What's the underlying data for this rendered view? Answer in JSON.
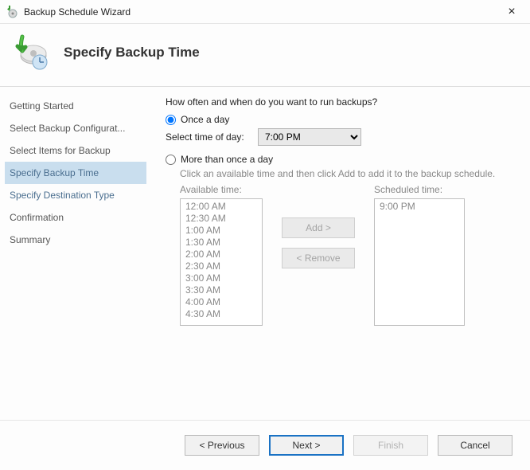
{
  "window": {
    "title": "Backup Schedule Wizard"
  },
  "header": {
    "heading": "Specify Backup Time"
  },
  "sidebar": {
    "items": [
      {
        "label": "Getting Started",
        "active": false
      },
      {
        "label": "Select Backup Configurat...",
        "active": false
      },
      {
        "label": "Select Items for Backup",
        "active": false
      },
      {
        "label": "Specify Backup Time",
        "active": true
      },
      {
        "label": "Specify Destination Type",
        "active": false
      },
      {
        "label": "Confirmation",
        "active": false
      },
      {
        "label": "Summary",
        "active": false
      }
    ]
  },
  "content": {
    "question": "How often and when do you want to run backups?",
    "once": {
      "label": "Once a day",
      "select_label": "Select time of day:",
      "selected_time": "7:00 PM"
    },
    "multi": {
      "label": "More than once a day",
      "instruction": "Click an available time and then click Add to add it to the backup schedule.",
      "available_label": "Available time:",
      "scheduled_label": "Scheduled time:",
      "available_times": [
        "12:00 AM",
        "12:30 AM",
        "1:00 AM",
        "1:30 AM",
        "2:00 AM",
        "2:30 AM",
        "3:00 AM",
        "3:30 AM",
        "4:00 AM",
        "4:30 AM"
      ],
      "scheduled_times": [
        "9:00 PM"
      ],
      "add_label": "Add >",
      "remove_label": "< Remove"
    }
  },
  "footer": {
    "previous": "< Previous",
    "next": "Next >",
    "finish": "Finish",
    "cancel": "Cancel"
  }
}
